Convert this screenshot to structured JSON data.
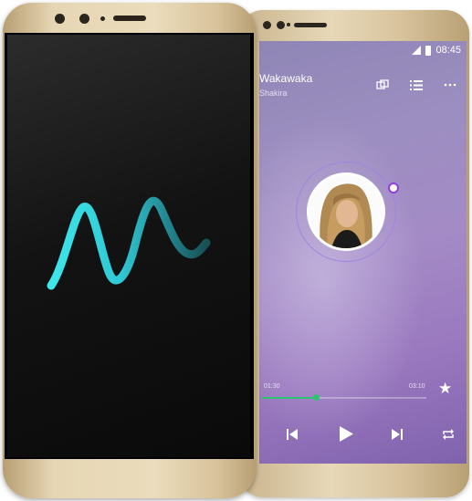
{
  "music_player": {
    "status_time": "08:45",
    "song_title": "Wakawaka",
    "artist": "Shakira",
    "time_elapsed": "01:30",
    "time_total": "03:10",
    "progress": 0.33
  },
  "colors": {
    "accent_green": "#2cc472",
    "ring_purple": "#8f3ee0",
    "wave_cyan": "#33d6e0"
  },
  "icons": {
    "top": [
      "multi-window-icon",
      "playlist-icon",
      "more-icon"
    ],
    "controls": [
      "previous-icon",
      "play-icon",
      "next-icon",
      "repeat-icon"
    ],
    "favorite": "star-icon"
  }
}
